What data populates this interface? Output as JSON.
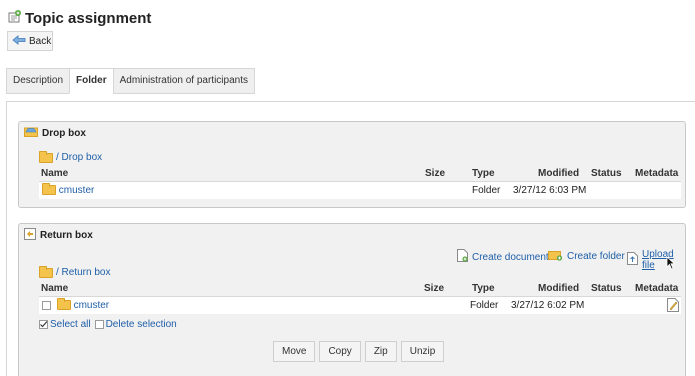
{
  "page": {
    "title": "Topic assignment",
    "back_label": "Back"
  },
  "tabs": [
    {
      "label": "Description",
      "active": false
    },
    {
      "label": "Folder",
      "active": true
    },
    {
      "label": "Administration of participants",
      "active": false
    }
  ],
  "drop_box": {
    "title": "Drop box",
    "path": "/ Drop box",
    "columns": {
      "name": "Name",
      "size": "Size",
      "type": "Type",
      "modified": "Modified",
      "status": "Status",
      "metadata": "Metadata"
    },
    "rows": [
      {
        "name": "cmuster",
        "size": "",
        "type": "Folder",
        "modified": "3/27/12 6:03 PM",
        "status": ""
      }
    ]
  },
  "return_box": {
    "title": "Return box",
    "path": "/ Return box",
    "toolbar": {
      "create_document": "Create document",
      "create_folder": "Create folder",
      "upload_file": "Upload file"
    },
    "columns": {
      "name": "Name",
      "size": "Size",
      "type": "Type",
      "modified": "Modified",
      "status": "Status",
      "metadata": "Metadata"
    },
    "rows": [
      {
        "name": "cmuster",
        "size": "",
        "type": "Folder",
        "modified": "3/27/12 6:02 PM",
        "status": ""
      }
    ],
    "select_all": "Select all",
    "delete_selection": "Delete selection",
    "actions": {
      "move": "Move",
      "copy": "Copy",
      "zip": "Zip",
      "unzip": "Unzip"
    }
  },
  "colors": {
    "link": "#1f5fa8",
    "panel_bg": "#f1f1f1",
    "folder": "#f3c34c"
  }
}
